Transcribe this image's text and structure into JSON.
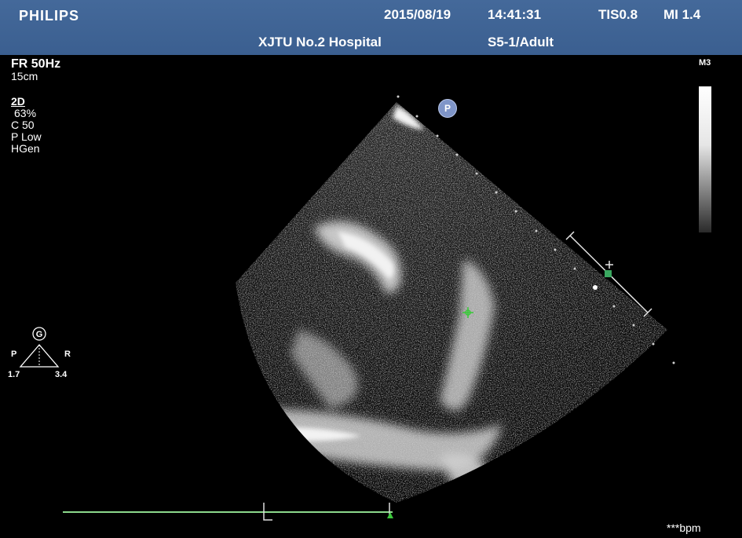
{
  "header": {
    "brand": "PHILIPS",
    "date": "2015/08/19",
    "time": "14:41:31",
    "tis": "TIS0.8",
    "mi": "MI 1.4",
    "hospital": "XJTU No.2 Hospital",
    "probe": "S5-1/Adult"
  },
  "params": {
    "frame_rate": "FR 50Hz",
    "depth": "15cm",
    "mode": "2D",
    "gain": "63%",
    "compression": "C 50",
    "power": "P Low",
    "frequency": "HGen"
  },
  "map": {
    "label": "M3"
  },
  "orientation": {
    "icon_letter": "G",
    "left_label": "P",
    "right_label": "R",
    "left_value": "1.7",
    "right_value": "3.4"
  },
  "marker": {
    "letter": "P"
  },
  "footer": {
    "bpm": "***bpm"
  },
  "colors": {
    "header_bg": "#3f6496",
    "caliper_green": "#3cc83c",
    "ecg_green": "#8cd98c",
    "marker_blue": "#7f95c8"
  }
}
